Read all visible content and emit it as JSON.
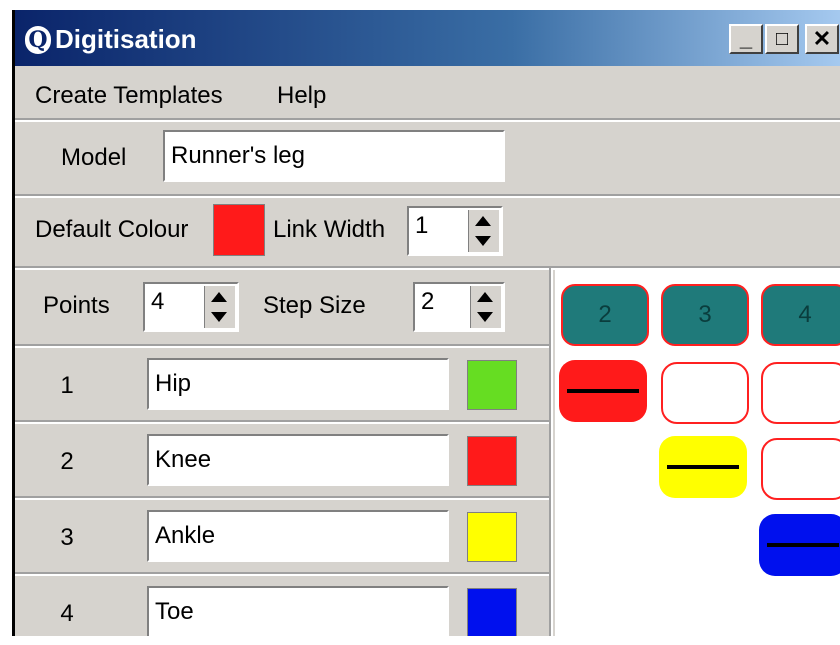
{
  "window": {
    "title": "Digitisation",
    "app_icon": "Q"
  },
  "titlebar_buttons": {
    "minimize": "_",
    "maximize": "□",
    "close": "✕"
  },
  "menu": {
    "items": [
      "Create Templates",
      "Help"
    ]
  },
  "model": {
    "label": "Model",
    "value": "Runner's leg"
  },
  "default_colour": {
    "label": "Default Colour",
    "color": "#ff1a1a"
  },
  "link_width": {
    "label": "Link Width",
    "value": "1"
  },
  "points": {
    "label": "Points",
    "value": "4"
  },
  "step_size": {
    "label": "Step Size",
    "value": "2"
  },
  "rows": [
    {
      "num": "1",
      "name": "Hip",
      "color": "#66dd22"
    },
    {
      "num": "2",
      "name": "Knee",
      "color": "#ff1a1a"
    },
    {
      "num": "3",
      "name": "Ankle",
      "color": "#ffff00"
    },
    {
      "num": "4",
      "name": "Toe",
      "color": "#0010ee"
    }
  ],
  "matrix": {
    "headers": [
      "2",
      "3",
      "4"
    ],
    "diagonal_colors": [
      "#ff1a1a",
      "#ffff00",
      "#0010ee"
    ]
  }
}
